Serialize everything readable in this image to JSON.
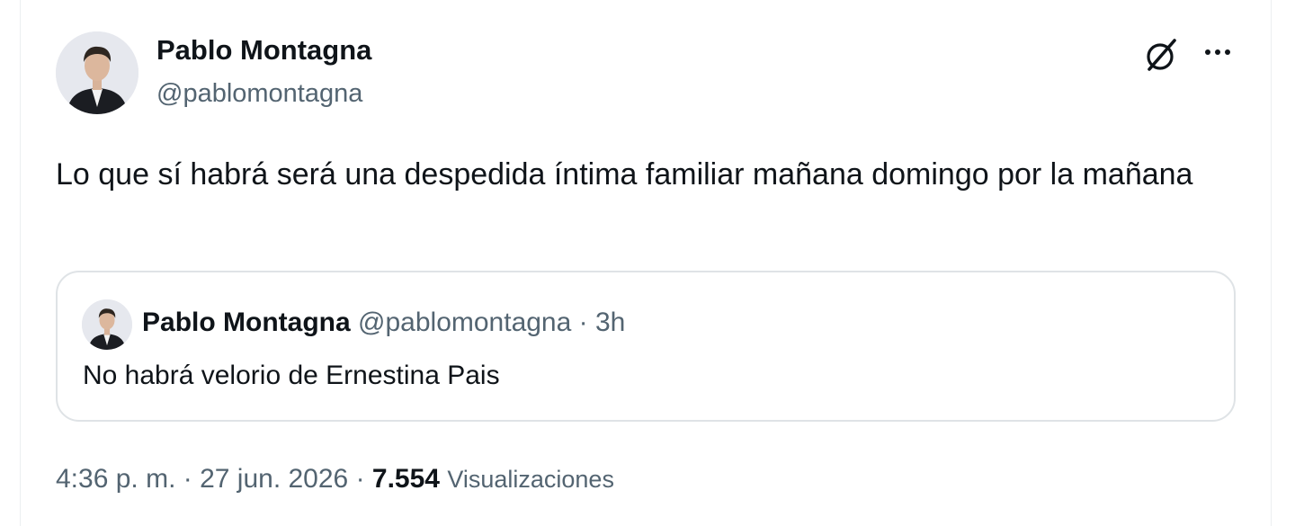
{
  "tweet": {
    "author_name": "Pablo Montagna",
    "author_handle": "@pablomontagna",
    "text": "Lo que sí habrá será una despedida íntima familiar mañana domingo por la mañana",
    "time": "4:36 p. m.",
    "separator": " · ",
    "date": "27 jun. 2026",
    "views_count": "7.554",
    "views_label": "Visualizaciones"
  },
  "quoted_tweet": {
    "author_name": "Pablo Montagna",
    "author_handle": "@pablomontagna",
    "separator": " · ",
    "age": "3h",
    "text": "No habrá velorio de Ernestina Pais"
  },
  "icons": {
    "grok": "grok-icon",
    "more": "more-options-icon"
  },
  "colors": {
    "primary_text": "#0f1419",
    "secondary_text": "#536471",
    "border": "#dfe3e6"
  }
}
